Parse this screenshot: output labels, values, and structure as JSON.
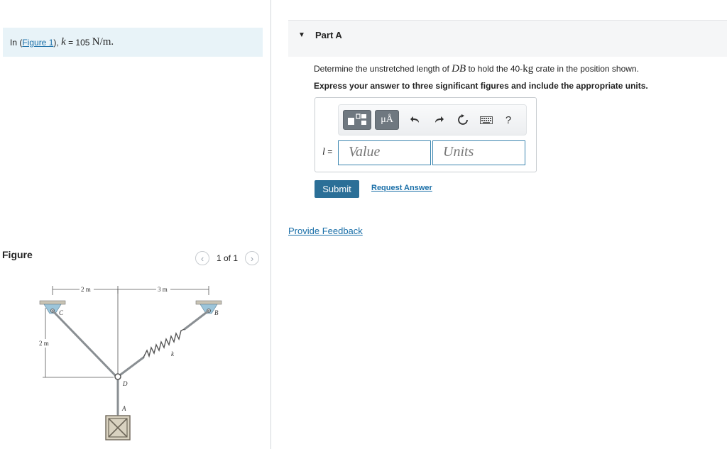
{
  "problem": {
    "prefix": "In (",
    "figure_link": "Figure 1",
    "suffix": "),",
    "k_var": "k",
    "equals": " = 105 ",
    "unit": "N/m."
  },
  "figure_panel": {
    "title": "Figure",
    "pager": "1 of 1",
    "prev_icon": "chevron-left-icon",
    "next_icon": "chevron-right-icon",
    "labels": {
      "dim_left": "2 m",
      "dim_right": "3 m",
      "dim_vertical": "2 m",
      "C": "C",
      "B": "B",
      "D": "D",
      "A": "A",
      "k": "k"
    }
  },
  "part": {
    "title": "Part A",
    "question_pre": "Determine the unstretched length of ",
    "question_var": "DB",
    "question_mid": " to hold the 40-",
    "question_unit": "kg",
    "question_post": " crate in the position shown.",
    "instruction": "Express your answer to three significant figures and include the appropriate units."
  },
  "toolbar": {
    "icons": [
      "template-icon",
      "mu-angstrom-icon",
      "undo-icon",
      "redo-icon",
      "reset-icon",
      "keyboard-icon",
      "help-icon"
    ],
    "mu_label": "μÅ",
    "help_label": "?"
  },
  "answer": {
    "variable": "l",
    "equals": " =",
    "value_placeholder": "Value",
    "units_placeholder": "Units"
  },
  "actions": {
    "submit": "Submit",
    "request": "Request Answer",
    "feedback": "Provide Feedback"
  }
}
